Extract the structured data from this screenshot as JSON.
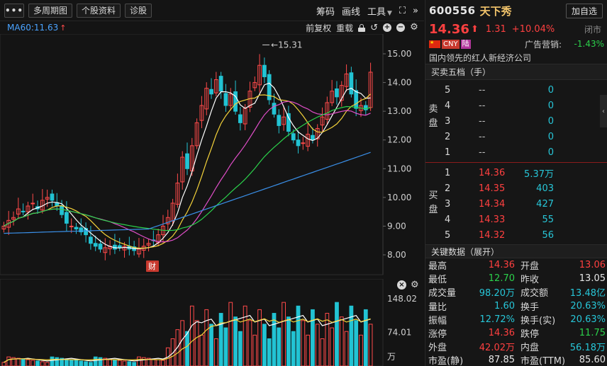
{
  "toolbar": {
    "more_label": "•••",
    "period_label": "多周期图",
    "profile_label": "个股资料",
    "diagnose_label": "诊股",
    "chips_label": "筹码",
    "draw_label": "画线",
    "tools_label": "工具",
    "tools_caret": "▼",
    "expand_glyph": "⛶",
    "collapse_glyph": "»"
  },
  "ma_bar": {
    "label": "MA60:11.63",
    "arrow": "↑",
    "forward_adjust": "前复权",
    "overlay": "重载"
  },
  "price_axis": [
    "15.00",
    "14.00",
    "13.00",
    "12.00",
    "11.00",
    "10.00",
    "9.00",
    "8.00"
  ],
  "kline": {
    "high_marker": "15.31",
    "event_badge": "财",
    "colors": {
      "up": "#ff4a4a",
      "down": "#22c3d3",
      "ma5": "#ffffff",
      "ma10": "#f5d33a",
      "ma20": "#e04ec8",
      "ma30": "#2bd14b",
      "ma60": "#3a8fe8"
    }
  },
  "volume_axis": [
    "148.02",
    "74.01",
    "万"
  ],
  "stock": {
    "code": "600556",
    "name": "天下秀",
    "add_watch": "加自选",
    "price": "14.36",
    "price_arrow": "⬆",
    "change": "1.31",
    "change_pct": "+10.04%",
    "status": "闭市",
    "tag_cny": "CNY",
    "tag_lu": "陆",
    "ad_label": "广告营销:",
    "ad_value": "-1.43%",
    "description": "国内领先的红人新经济公司"
  },
  "order_book": {
    "title": "买卖五档（手）",
    "sell_label": "卖\n盘",
    "buy_label": "买\n盘",
    "asks": [
      {
        "level": "5",
        "price": "--",
        "vol": "0"
      },
      {
        "level": "4",
        "price": "--",
        "vol": "0"
      },
      {
        "level": "3",
        "price": "--",
        "vol": "0"
      },
      {
        "level": "2",
        "price": "--",
        "vol": "0"
      },
      {
        "level": "1",
        "price": "--",
        "vol": "0"
      }
    ],
    "bids": [
      {
        "level": "1",
        "price": "14.36",
        "vol": "5.37万"
      },
      {
        "level": "2",
        "price": "14.35",
        "vol": "403"
      },
      {
        "level": "3",
        "price": "14.34",
        "vol": "427"
      },
      {
        "level": "4",
        "price": "14.33",
        "vol": "55"
      },
      {
        "level": "5",
        "price": "14.32",
        "vol": "56"
      }
    ],
    "collapse_glyph": "‹"
  },
  "stats": {
    "title": "关键数据（展开）",
    "rows": [
      {
        "k1": "最高",
        "v1": "14.36",
        "c1": "red",
        "k2": "开盘",
        "v2": "13.06",
        "c2": "red"
      },
      {
        "k1": "最低",
        "v1": "12.70",
        "c1": "green",
        "k2": "昨收",
        "v2": "13.05",
        "c2": "white"
      },
      {
        "k1": "成交量",
        "v1": "98.20万",
        "c1": "cyan",
        "k2": "成交额",
        "v2": "13.48亿",
        "c2": "cyan"
      },
      {
        "k1": "量比",
        "v1": "1.60",
        "c1": "cyan",
        "k2": "换手",
        "v2": "20.63%",
        "c2": "cyan"
      },
      {
        "k1": "振幅",
        "v1": "12.72%",
        "c1": "cyan",
        "k2": "换手(实)",
        "v2": "20.63%",
        "c2": "cyan"
      },
      {
        "k1": "涨停",
        "v1": "14.36",
        "c1": "red",
        "k2": "跌停",
        "v2": "11.75",
        "c2": "green"
      },
      {
        "k1": "外盘",
        "v1": "42.02万",
        "c1": "red",
        "k2": "内盘",
        "v2": "56.18万",
        "c2": "cyan"
      },
      {
        "k1": "市盈(静)",
        "v1": "87.85",
        "c1": "white",
        "k2": "市盈(TTM)",
        "v2": "85.60",
        "c2": "white"
      }
    ]
  }
}
